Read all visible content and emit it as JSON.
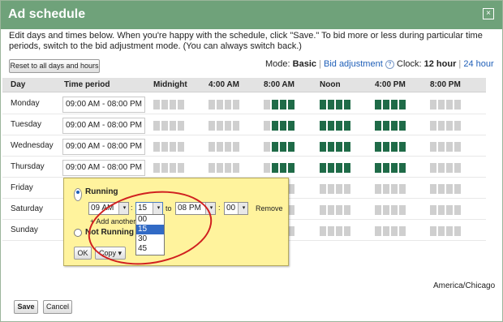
{
  "dialog": {
    "title": "Ad schedule",
    "intro": "Edit days and times below. When you're happy with the schedule, click \"Save.\" To bid more or less during particular time periods, switch to the bid adjustment mode. (You can always switch back.)",
    "reset_label": "Reset to all days and hours",
    "mode_label": "Mode:",
    "mode_basic": "Basic",
    "mode_sep": "|",
    "mode_bid": "Bid adjustment",
    "help": "?",
    "clock_label": "Clock:",
    "clock_12": "12 hour",
    "clock_sep": "|",
    "clock_24": "24 hour",
    "close": "×",
    "timezone": "America/Chicago",
    "save_label": "Save",
    "cancel_label": "Cancel"
  },
  "table": {
    "headers": {
      "day": "Day",
      "time_period": "Time period",
      "midnight": "Midnight",
      "am4": "4:00 AM",
      "am8": "8:00 AM",
      "noon": "Noon",
      "pm4": "4:00 PM",
      "pm8": "8:00 PM"
    },
    "rows": [
      {
        "day": "Monday",
        "period": "09:00 AM - 08:00 PM"
      },
      {
        "day": "Tuesday",
        "period": "09:00 AM - 08:00 PM"
      },
      {
        "day": "Wednesday",
        "period": "09:00 AM - 08:00 PM"
      },
      {
        "day": "Thursday",
        "period": "09:00 AM - 08:00 PM"
      },
      {
        "day": "Friday",
        "period": ""
      },
      {
        "day": "Saturday",
        "period": ""
      },
      {
        "day": "Sunday",
        "period": ""
      }
    ],
    "active_hours": [
      9,
      20
    ],
    "colors": {
      "active": "#1f6b48",
      "inactive": "#cfcfcf",
      "titlebar": "#6fa27a",
      "popup": "#fff39d",
      "highlight": "#316ac5",
      "annotation": "#d02020"
    }
  },
  "popup": {
    "running": "Running",
    "not_running": "Not Running",
    "from_hour": "09 AM",
    "from_minute": "15",
    "to_label": "to",
    "to_hour": "08 PM",
    "to_minute": "00",
    "colon": ":",
    "remove": "Remove",
    "add_another": "+ Add another ti",
    "ok": "OK",
    "copy": "Copy ▾",
    "minute_options": [
      "00",
      "15",
      "30",
      "45"
    ],
    "selected_minute": "15",
    "dropdown_arrow": "▾"
  }
}
